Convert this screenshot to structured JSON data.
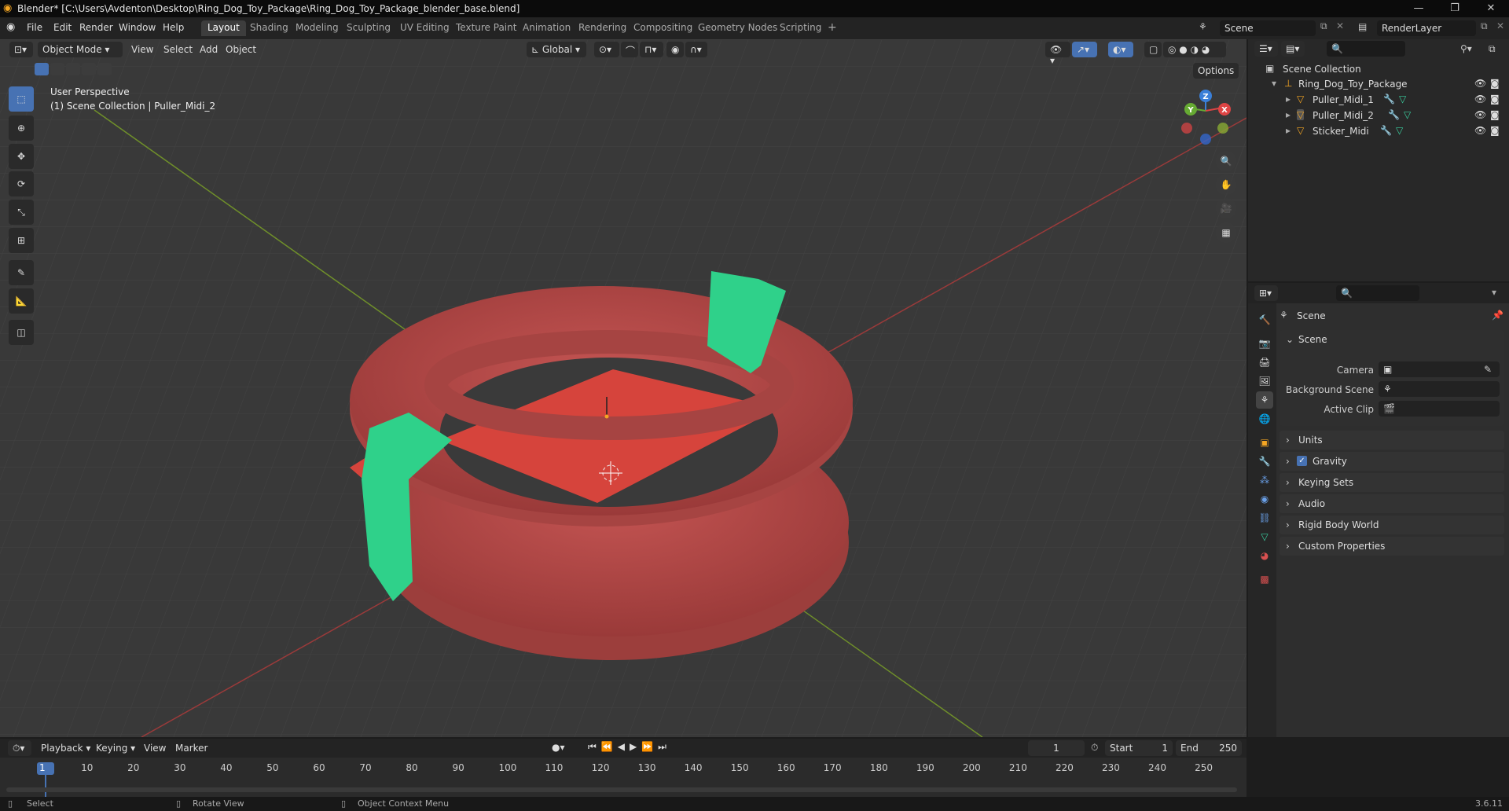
{
  "window": {
    "title": "Blender* [C:\\Users\\Avdenton\\Desktop\\Ring_Dog_Toy_Package\\Ring_Dog_Toy_Package_blender_base.blend]",
    "controls": [
      "—",
      "❐",
      "✕"
    ]
  },
  "menus": [
    "File",
    "Edit",
    "Render",
    "Window",
    "Help"
  ],
  "workspaces": [
    "Layout",
    "Shading",
    "Modeling",
    "Sculpting",
    "UV Editing",
    "Texture Paint",
    "Animation",
    "Rendering",
    "Compositing",
    "Geometry Nodes",
    "Scripting"
  ],
  "active_workspace": "Layout",
  "scene_field": "Scene",
  "renderlayer_field": "RenderLayer",
  "viewport": {
    "mode": "Object Mode",
    "menus": [
      "View",
      "Select",
      "Add",
      "Object"
    ],
    "orientation": "Global",
    "options_label": "Options",
    "overlay_line1": "User Perspective",
    "overlay_line2": "(1) Scene Collection | Puller_Midi_2",
    "gizmo": {
      "x": "X",
      "y": "Y",
      "z": "Z"
    },
    "colors": {
      "ring": "#b94a48",
      "sticker": "#2fd18a",
      "plane": "#d6443c",
      "x_axis": "#c94a4a",
      "y_axis": "#7a9a2a"
    }
  },
  "outliner": {
    "root": "Scene Collection",
    "collection": "Ring_Dog_Toy_Package",
    "objects": [
      "Puller_Midi_1",
      "Puller_Midi_2",
      "Sticker_Midi"
    ]
  },
  "properties": {
    "header": "Scene",
    "section": "Scene",
    "fields": [
      {
        "label": "Camera",
        "value": ""
      },
      {
        "label": "Background Scene",
        "value": ""
      },
      {
        "label": "Active Clip",
        "value": ""
      }
    ],
    "panels": [
      "Units",
      "Gravity",
      "Keying Sets",
      "Audio",
      "Rigid Body World",
      "Custom Properties"
    ],
    "gravity_checked": true
  },
  "timeline": {
    "menus": [
      "Playback",
      "Keying",
      "View",
      "Marker"
    ],
    "current_frame": "1",
    "start_label": "Start",
    "start": "1",
    "end_label": "End",
    "end": "250",
    "ticks": [
      "1",
      "10",
      "20",
      "30",
      "40",
      "50",
      "60",
      "70",
      "80",
      "90",
      "100",
      "110",
      "120",
      "130",
      "140",
      "150",
      "160",
      "170",
      "180",
      "190",
      "200",
      "210",
      "220",
      "230",
      "240",
      "250"
    ]
  },
  "status": {
    "items": [
      "Select",
      "Rotate View",
      "Object Context Menu"
    ],
    "version": "3.6.11"
  }
}
